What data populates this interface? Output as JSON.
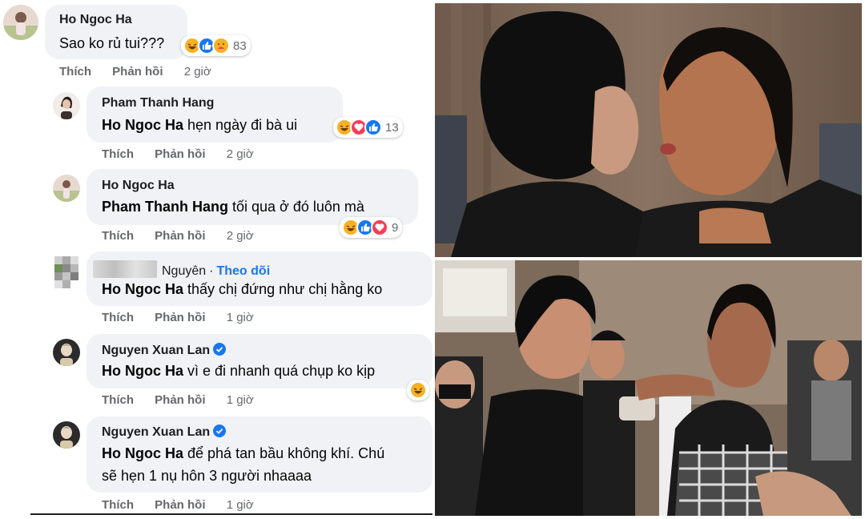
{
  "comments": [
    {
      "author": "Ho Ngoc Ha",
      "mention": "",
      "text": "Sao ko rủ tui???",
      "reactions": [
        "haha",
        "like",
        "care"
      ],
      "count": "83",
      "like": "Thích",
      "reply": "Phản hồi",
      "time": "2 giờ"
    },
    {
      "author": "Pham Thanh Hang",
      "mention": "Ho Ngoc Ha",
      "text": " hẹn ngày đi bà ui",
      "reactions": [
        "haha",
        "love",
        "like"
      ],
      "count": "13",
      "like": "Thích",
      "reply": "Phản hồi",
      "time": "2 giờ"
    },
    {
      "author": "Ho Ngoc Ha",
      "mention": "Pham Thanh Hang",
      "text": " tối qua ở đó luôn mà",
      "reactions": [
        "haha",
        "like",
        "love"
      ],
      "count": "9",
      "like": "Thích",
      "reply": "Phản hồi",
      "time": "2 giờ"
    },
    {
      "author": "Nguyên",
      "follow": "Theo dõi",
      "mention": "Ho Ngoc Ha",
      "text": " thấy chị đứng như chị hằng ko",
      "like": "Thích",
      "reply": "Phản hồi",
      "time": "1 giờ"
    },
    {
      "author": "Nguyen Xuan Lan",
      "mention": "Ho Ngoc Ha",
      "text": " vì e đi nhanh quá chụp ko kịp",
      "reactions": [
        "haha"
      ],
      "like": "Thích",
      "reply": "Phản hồi",
      "time": "1 giờ"
    },
    {
      "author": "Nguyen Xuan Lan",
      "mention": "Ho Ngoc Ha",
      "text": " để phá tan bầu không khí. Chú",
      "text2": "sẽ hẹn 1 nụ hôn 3 người nhaaaa",
      "like": "Thích",
      "reply": "Phản hồi",
      "time": "1 giờ"
    }
  ],
  "separator": "·",
  "colors": {
    "bubble": "#f0f2f5",
    "link": "#1877f2",
    "meta": "#65676b",
    "haha": "#f7b125",
    "love": "#f33e58",
    "like": "#1877f2"
  }
}
